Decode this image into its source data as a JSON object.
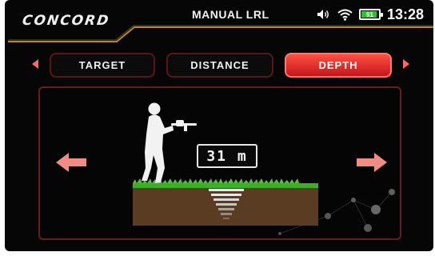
{
  "header": {
    "logo_text": "CONCORD",
    "mode_title": "MANUAL LRL",
    "battery_level": "91",
    "battery_fraction": 0.91,
    "time": "13:28"
  },
  "tabs": [
    {
      "label": "TARGET",
      "active": false
    },
    {
      "label": "DISTANCE",
      "active": false
    },
    {
      "label": "DEPTH",
      "active": true
    }
  ],
  "main": {
    "depth_readout": "31 m"
  },
  "icons": {
    "volume": "volume-icon",
    "wifi": "wifi-icon",
    "battery": "battery-icon",
    "prev": "chevron-left-icon",
    "next": "chevron-right-icon",
    "arrow_left": "arrow-left-icon",
    "arrow_right": "arrow-right-icon",
    "operator": "person-with-detector-icon"
  },
  "colors": {
    "accent": "#e0332a",
    "frame": "#b8862b",
    "grass": "#3cae2a",
    "soil": "#5a3c22"
  }
}
